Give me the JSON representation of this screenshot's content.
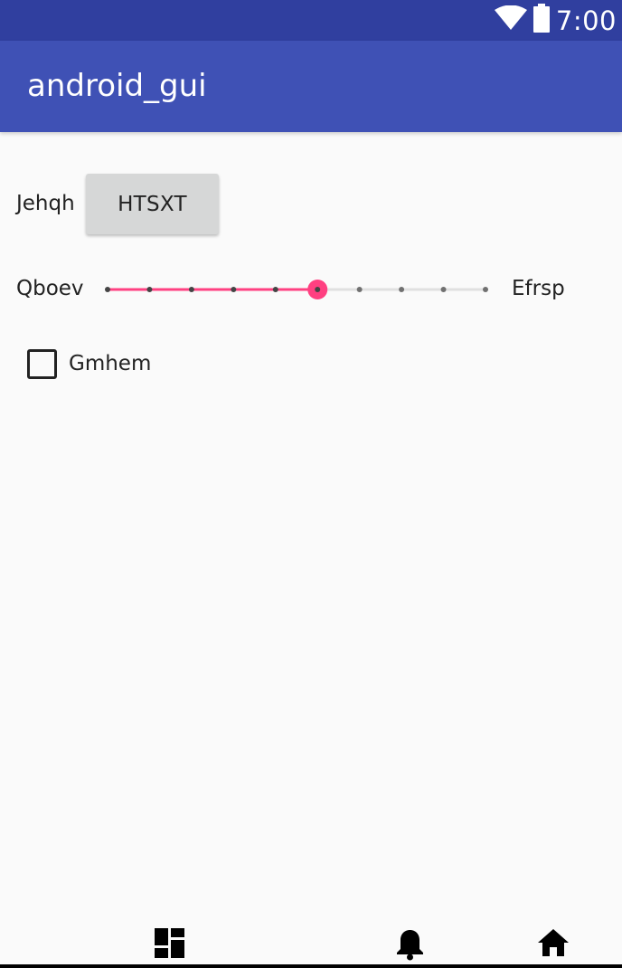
{
  "status_bar": {
    "time": "7:00",
    "icons": [
      "wifi-icon",
      "battery-icon"
    ]
  },
  "app_bar": {
    "title": "android_gui"
  },
  "form": {
    "row1_label": "Jehqh",
    "button_label": "HTSXT",
    "slider_min_label": "Qboev",
    "slider_max_label": "Efrsp",
    "slider_value": 5,
    "slider_max": 10,
    "checkbox_label": "Gmhem",
    "checkbox_checked": false
  },
  "bottom_nav": {
    "icons": [
      "dashboard-icon",
      "bell-icon",
      "home-icon"
    ]
  },
  "colors": {
    "status_bar": "#303f9f",
    "app_bar": "#3f51b5",
    "accent": "#ff4081",
    "background": "#fafafa"
  }
}
